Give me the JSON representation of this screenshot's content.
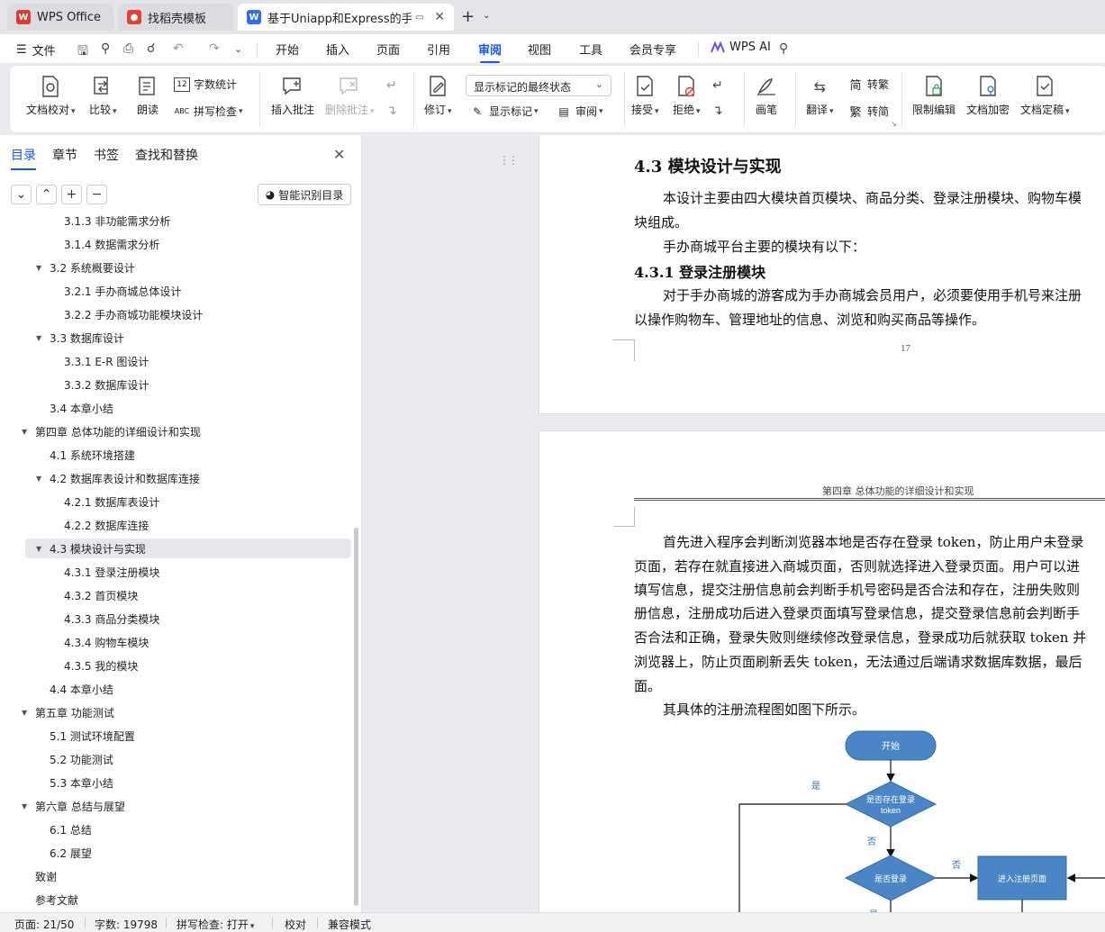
{
  "tabs": [
    {
      "label": "WPS Office",
      "icon": "wps-logo-icon"
    },
    {
      "label": "找稻壳模板",
      "icon": "docer-icon"
    },
    {
      "label": "基于Uniapp和Express的手办",
      "icon": "word-doc-icon",
      "active": true
    }
  ],
  "menubar": {
    "file_label": "文件",
    "items": [
      "开始",
      "插入",
      "页面",
      "引用",
      "审阅",
      "视图",
      "工具",
      "会员专享"
    ],
    "active": "审阅",
    "ai_label": "WPS AI"
  },
  "ribbon": {
    "doc_check": "文档校对",
    "compare": "比较",
    "read_aloud": "朗读",
    "word_count": "字数统计",
    "spell_check": "拼写检查",
    "insert_comment": "插入批注",
    "delete_comment": "删除批注",
    "revise": "修订",
    "markup_mode": "显示标记的最终状态",
    "show_markup": "显示标记",
    "review": "审阅",
    "accept": "接受",
    "reject": "拒绝",
    "pen": "画笔",
    "translate": "翻译",
    "to_traditional": "转繁",
    "to_simplified": "转简",
    "restrict_edit": "限制编辑",
    "encrypt": "文档加密",
    "finalize": "文档定稿"
  },
  "nav": {
    "tabs": [
      "目录",
      "章节",
      "书签",
      "查找和替换"
    ],
    "active_tab": "目录",
    "smart_toc": "智能识别目录",
    "toc": [
      {
        "label": "3.1.3 非功能需求分析",
        "level": 3
      },
      {
        "label": "3.1.4 数据需求分析",
        "level": 3
      },
      {
        "label": "3.2 系统概要设计",
        "level": 2,
        "expanded": true
      },
      {
        "label": "3.2.1 手办商城总体设计",
        "level": 3
      },
      {
        "label": "3.2.2 手办商城功能模块设计",
        "level": 3
      },
      {
        "label": "3.3 数据库设计",
        "level": 2,
        "expanded": true
      },
      {
        "label": "3.3.1 E-R 图设计",
        "level": 3
      },
      {
        "label": "3.3.2 数据库设计",
        "level": 3
      },
      {
        "label": "3.4 本章小结",
        "level": 2
      },
      {
        "label": "第四章 总体功能的详细设计和实现",
        "level": 1,
        "expanded": true
      },
      {
        "label": "4.1 系统环境搭建",
        "level": 2
      },
      {
        "label": "4.2 数据库表设计和数据库连接",
        "level": 2,
        "expanded": true
      },
      {
        "label": "4.2.1   数据库表设计",
        "level": 3
      },
      {
        "label": "4.2.2   数据库连接",
        "level": 3
      },
      {
        "label": "4.3 模块设计与实现",
        "level": 2,
        "expanded": true,
        "selected": true
      },
      {
        "label": "4.3.1 登录注册模块",
        "level": 3
      },
      {
        "label": "4.3.2 首页模块",
        "level": 3
      },
      {
        "label": "4.3.3 商品分类模块",
        "level": 3
      },
      {
        "label": "4.3.4 购物车模块",
        "level": 3
      },
      {
        "label": "4.3.5 我的模块",
        "level": 3
      },
      {
        "label": "4.4 本章小结",
        "level": 2
      },
      {
        "label": "第五章 功能测试",
        "level": 1,
        "expanded": true
      },
      {
        "label": "5.1 测试环境配置",
        "level": 2
      },
      {
        "label": "5.2 功能测试",
        "level": 2
      },
      {
        "label": "5.3 本章小结",
        "level": 2
      },
      {
        "label": "第六章 总结与展望",
        "level": 1,
        "expanded": true
      },
      {
        "label": "6.1 总结",
        "level": 2
      },
      {
        "label": "6.2 展望",
        "level": 2
      },
      {
        "label": "致谢",
        "level": 1
      },
      {
        "label": "参考文献",
        "level": 1
      }
    ]
  },
  "doc": {
    "page1": {
      "h2": "4.3  模块设计与实现",
      "p1a": "本设计主要由四大模块首页模块、商品分类、登录注册模块、购物车模",
      "p1b": "块组成。",
      "p2": "手办商城平台主要的模块有以下：",
      "h3": "4.3.1  登录注册模块",
      "p3a": "对于手办商城的游客成为手办商城会员用户，必须要使用手机号来注册",
      "p3b": "以操作购物车、管理地址的信息、浏览和购买商品等操作。",
      "page_number": "17"
    },
    "page2": {
      "header": "第四章  总体功能的详细设计和实现",
      "lines": [
        "首先进入程序会判断浏览器本地是否存在登录 token，防止用户未登录",
        "页面，若存在就直接进入商城页面，否则就选择进入登录页面。用户可以进",
        "填写信息，提交注册信息前会判断手机号密码是否合法和存在，注册失败则",
        "册信息，注册成功后进入登录页面填写登录信息，提交登录信息前会判断手",
        "否合法和正确，登录失败则继续修改登录信息，登录成功后就获取 token 并",
        "浏览器上，防止页面刷新丢失 token，无法通过后端请求数据库数据，最后",
        "面。"
      ],
      "p_flow": "其具体的注册流程图如图下所示。",
      "flow": {
        "start": "开始",
        "d1_line1": "是否存在登录",
        "d1_line2": "token",
        "d2": "是否登录",
        "reg": "进入注册页面",
        "yes": "是",
        "no": "否"
      }
    }
  },
  "status": {
    "page": "页面: 21/50",
    "words": "字数: 19798",
    "spell": "拼写检查: 打开",
    "proof": "校对",
    "compat": "兼容模式"
  },
  "colors": {
    "accent": "#1456f0",
    "flow_fill": "#4a86c5",
    "flow_stroke": "#2f6aa8"
  }
}
